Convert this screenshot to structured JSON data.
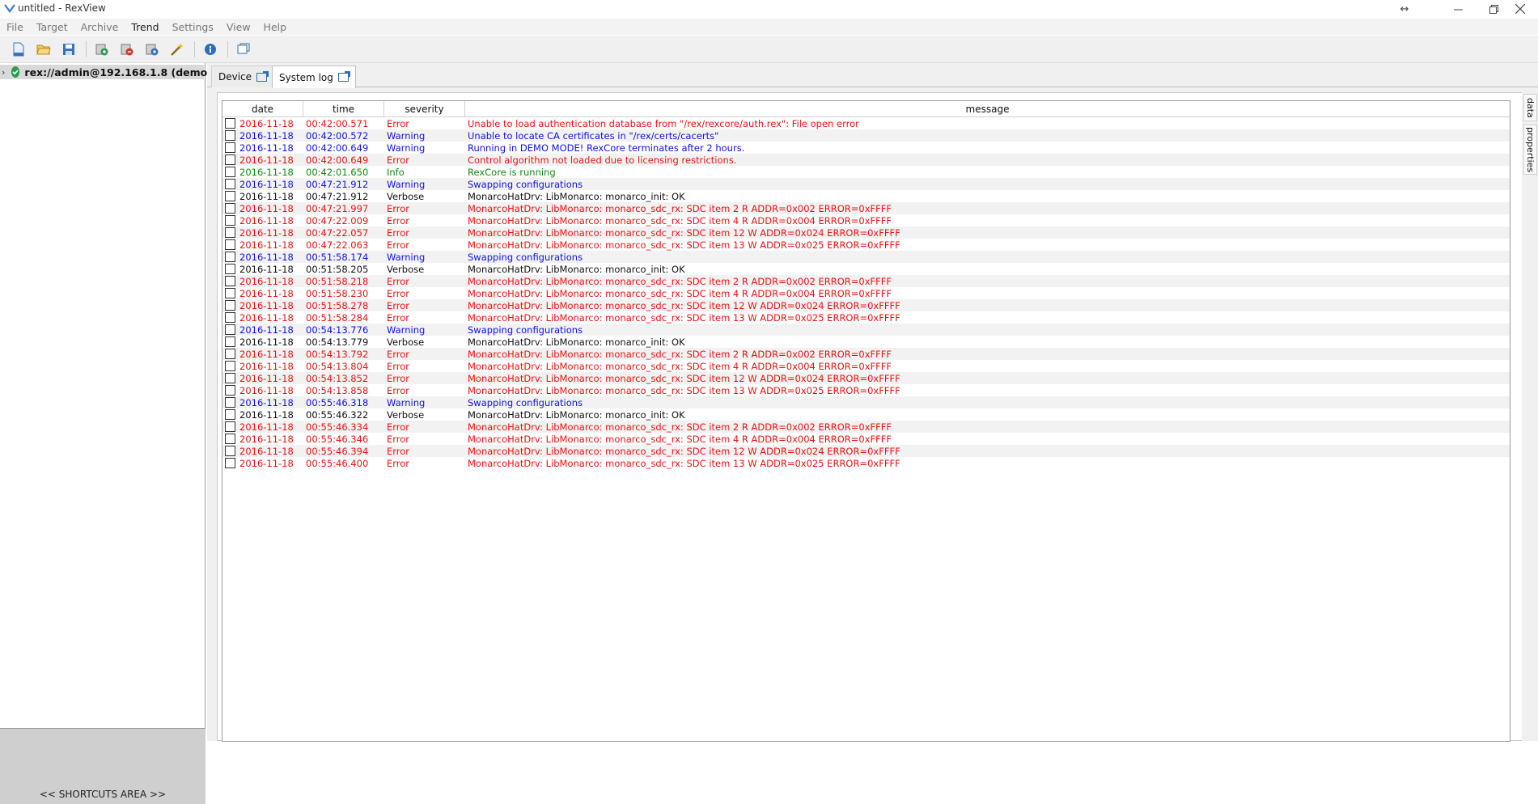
{
  "window": {
    "title": "untitled - RexView"
  },
  "menu": [
    "File",
    "Target",
    "Archive",
    "Trend",
    "Settings",
    "View",
    "Help"
  ],
  "tree": {
    "label": "rex://admin@192.168.1.8 (demo ..."
  },
  "shortcuts": {
    "label": "<< SHORTCUTS AREA >>"
  },
  "tabs": [
    {
      "label": "Device",
      "active": false
    },
    {
      "label": "System log",
      "active": true
    }
  ],
  "side_tabs": [
    "data",
    "properties"
  ],
  "log": {
    "columns": {
      "date": "date",
      "time": "time",
      "severity": "severity",
      "message": "message"
    },
    "rows": [
      {
        "date": "2016-11-18",
        "time": "00:42:00.571",
        "severity": "Error",
        "message": "Unable to load authentication database from \"/rex/rexcore/auth.rex\": File open error"
      },
      {
        "date": "2016-11-18",
        "time": "00:42:00.572",
        "severity": "Warning",
        "message": "Unable to locate CA certificates in \"/rex/certs/cacerts\""
      },
      {
        "date": "2016-11-18",
        "time": "00:42:00.649",
        "severity": "Warning",
        "message": "Running in DEMO MODE! RexCore terminates after 2 hours."
      },
      {
        "date": "2016-11-18",
        "time": "00:42:00.649",
        "severity": "Error",
        "message": "Control algorithm not loaded due to licensing restrictions."
      },
      {
        "date": "2016-11-18",
        "time": "00:42:01.650",
        "severity": "Info",
        "message": "RexCore is running"
      },
      {
        "date": "2016-11-18",
        "time": "00:47:21.912",
        "severity": "Warning",
        "message": "Swapping configurations"
      },
      {
        "date": "2016-11-18",
        "time": "00:47:21.912",
        "severity": "Verbose",
        "message": "MonarcoHatDrv: LibMonarco: monarco_init: OK"
      },
      {
        "date": "2016-11-18",
        "time": "00:47:21.997",
        "severity": "Error",
        "message": "MonarcoHatDrv: LibMonarco: monarco_sdc_rx: SDC item 2 R ADDR=0x002 ERROR=0xFFFF"
      },
      {
        "date": "2016-11-18",
        "time": "00:47:22.009",
        "severity": "Error",
        "message": "MonarcoHatDrv: LibMonarco: monarco_sdc_rx: SDC item 4 R ADDR=0x004 ERROR=0xFFFF"
      },
      {
        "date": "2016-11-18",
        "time": "00:47:22.057",
        "severity": "Error",
        "message": "MonarcoHatDrv: LibMonarco: monarco_sdc_rx: SDC item 12 W ADDR=0x024 ERROR=0xFFFF"
      },
      {
        "date": "2016-11-18",
        "time": "00:47:22.063",
        "severity": "Error",
        "message": "MonarcoHatDrv: LibMonarco: monarco_sdc_rx: SDC item 13 W ADDR=0x025 ERROR=0xFFFF"
      },
      {
        "date": "2016-11-18",
        "time": "00:51:58.174",
        "severity": "Warning",
        "message": "Swapping configurations"
      },
      {
        "date": "2016-11-18",
        "time": "00:51:58.205",
        "severity": "Verbose",
        "message": "MonarcoHatDrv: LibMonarco: monarco_init: OK"
      },
      {
        "date": "2016-11-18",
        "time": "00:51:58.218",
        "severity": "Error",
        "message": "MonarcoHatDrv: LibMonarco: monarco_sdc_rx: SDC item 2 R ADDR=0x002 ERROR=0xFFFF"
      },
      {
        "date": "2016-11-18",
        "time": "00:51:58.230",
        "severity": "Error",
        "message": "MonarcoHatDrv: LibMonarco: monarco_sdc_rx: SDC item 4 R ADDR=0x004 ERROR=0xFFFF"
      },
      {
        "date": "2016-11-18",
        "time": "00:51:58.278",
        "severity": "Error",
        "message": "MonarcoHatDrv: LibMonarco: monarco_sdc_rx: SDC item 12 W ADDR=0x024 ERROR=0xFFFF"
      },
      {
        "date": "2016-11-18",
        "time": "00:51:58.284",
        "severity": "Error",
        "message": "MonarcoHatDrv: LibMonarco: monarco_sdc_rx: SDC item 13 W ADDR=0x025 ERROR=0xFFFF"
      },
      {
        "date": "2016-11-18",
        "time": "00:54:13.776",
        "severity": "Warning",
        "message": "Swapping configurations"
      },
      {
        "date": "2016-11-18",
        "time": "00:54:13.779",
        "severity": "Verbose",
        "message": "MonarcoHatDrv: LibMonarco: monarco_init: OK"
      },
      {
        "date": "2016-11-18",
        "time": "00:54:13.792",
        "severity": "Error",
        "message": "MonarcoHatDrv: LibMonarco: monarco_sdc_rx: SDC item 2 R ADDR=0x002 ERROR=0xFFFF"
      },
      {
        "date": "2016-11-18",
        "time": "00:54:13.804",
        "severity": "Error",
        "message": "MonarcoHatDrv: LibMonarco: monarco_sdc_rx: SDC item 4 R ADDR=0x004 ERROR=0xFFFF"
      },
      {
        "date": "2016-11-18",
        "time": "00:54:13.852",
        "severity": "Error",
        "message": "MonarcoHatDrv: LibMonarco: monarco_sdc_rx: SDC item 12 W ADDR=0x024 ERROR=0xFFFF"
      },
      {
        "date": "2016-11-18",
        "time": "00:54:13.858",
        "severity": "Error",
        "message": "MonarcoHatDrv: LibMonarco: monarco_sdc_rx: SDC item 13 W ADDR=0x025 ERROR=0xFFFF"
      },
      {
        "date": "2016-11-18",
        "time": "00:55:46.318",
        "severity": "Warning",
        "message": "Swapping configurations"
      },
      {
        "date": "2016-11-18",
        "time": "00:55:46.322",
        "severity": "Verbose",
        "message": "MonarcoHatDrv: LibMonarco: monarco_init: OK"
      },
      {
        "date": "2016-11-18",
        "time": "00:55:46.334",
        "severity": "Error",
        "message": "MonarcoHatDrv: LibMonarco: monarco_sdc_rx: SDC item 2 R ADDR=0x002 ERROR=0xFFFF"
      },
      {
        "date": "2016-11-18",
        "time": "00:55:46.346",
        "severity": "Error",
        "message": "MonarcoHatDrv: LibMonarco: monarco_sdc_rx: SDC item 4 R ADDR=0x004 ERROR=0xFFFF"
      },
      {
        "date": "2016-11-18",
        "time": "00:55:46.394",
        "severity": "Error",
        "message": "MonarcoHatDrv: LibMonarco: monarco_sdc_rx: SDC item 12 W ADDR=0x024 ERROR=0xFFFF"
      },
      {
        "date": "2016-11-18",
        "time": "00:55:46.400",
        "severity": "Error",
        "message": "MonarcoHatDrv: LibMonarco: monarco_sdc_rx: SDC item 13 W ADDR=0x025 ERROR=0xFFFF"
      }
    ]
  },
  "colors": {
    "Error": "#ee1111",
    "Warning": "#1111ee",
    "Info": "#118811",
    "Verbose": "#111111"
  }
}
